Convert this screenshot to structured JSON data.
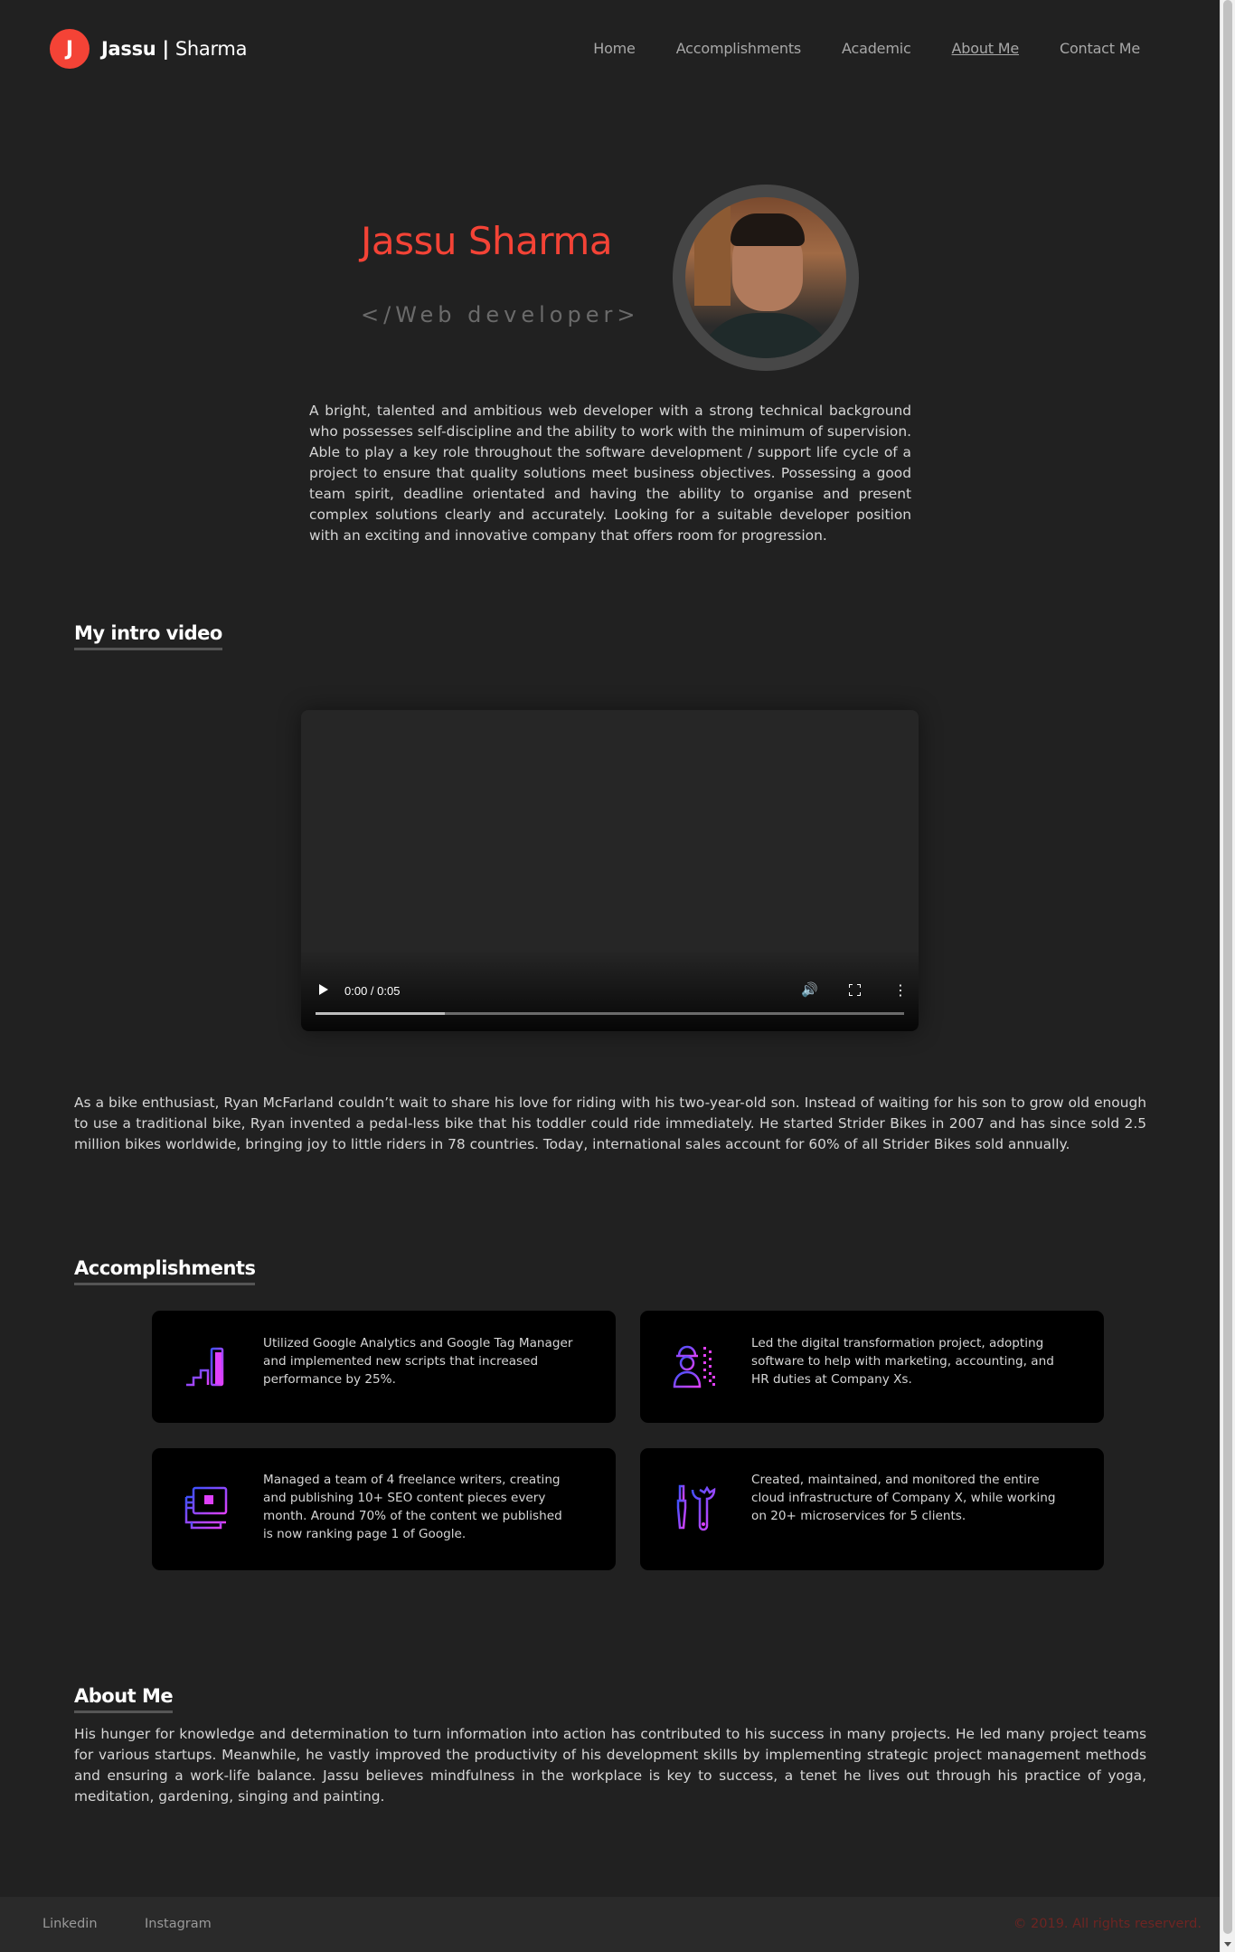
{
  "nav": {
    "logo_letter": "J",
    "brand_first": "Jassu",
    "brand_sep": " | ",
    "brand_last": "Sharma",
    "links": [
      "Home",
      "Accomplishments",
      "Academic",
      "About Me",
      "Contact Me"
    ],
    "active": "About Me"
  },
  "hero": {
    "name": "Jassu Sharma",
    "role": "</Web developer>",
    "intro": "A bright, talented and ambitious web developer with a strong technical background who possesses self-discipline and the ability to work with the minimum of supervision. Able to play a key role throughout the software development / support life cycle of a project to ensure that quality solutions meet business objectives. Possessing a good team spirit, deadline orientated and having the ability to organise and present complex solutions clearly and accurately. Looking for a suitable developer position with an exciting and innovative company that offers room for progression."
  },
  "video_section": {
    "title": "My intro video",
    "time": "0:00 / 0:05",
    "buffered_fraction": 0.22,
    "text": "As a bike enthusiast, Ryan McFarland couldn’t wait to share his love for riding with his two-year-old son. Instead of waiting for his son to grow old enough to use a traditional bike, Ryan invented a pedal-less bike that his toddler could ride immediately. He started Strider Bikes in 2007 and has since sold 2.5 million bikes worldwide, bringing joy to little riders in 78 countries. Today, international sales account for 60% of all Strider Bikes sold annually."
  },
  "accomplishments": {
    "title": "Accomplishments",
    "cards": [
      {
        "icon": "growth-chart-icon",
        "text": "Utilized Google Analytics and Google Tag Manager and implemented new scripts that increased performance by 25%."
      },
      {
        "icon": "engineer-icon",
        "text": "Led the digital transformation project, adopting software to help with marketing, accounting, and HR duties at Company Xs."
      },
      {
        "icon": "computer-icon",
        "text": "Managed a team of 4 freelance writers, creating and publishing 10+ SEO content pieces every month. Around 70% of the content we published is now ranking page 1 of Google."
      },
      {
        "icon": "tools-icon",
        "text": "Created, maintained, and monitored the entire cloud infrastructure of Company X, while working on 20+ microservices for 5 clients."
      }
    ]
  },
  "about": {
    "title": "About Me",
    "text": "His hunger for knowledge and determination to turn information into action has contributed to his success in many projects. He led many project teams for various startups. Meanwhile, he vastly improved the productivity of his development skills by implementing strategic project management methods and ensuring a work-life balance. Jassu believes mindfulness in the workplace is key to success, a tenet he lives out through his practice of yoga, meditation, gardening, singing and painting."
  },
  "footer": {
    "links": [
      "Linkedin",
      "Instagram"
    ],
    "copyright": "© 2019. All rights reserverd."
  },
  "colors": {
    "accent": "#f44336",
    "background": "#212121",
    "card": "#000000",
    "icon_gradient_start": "#3f51ff",
    "icon_gradient_end": "#e040fb"
  }
}
